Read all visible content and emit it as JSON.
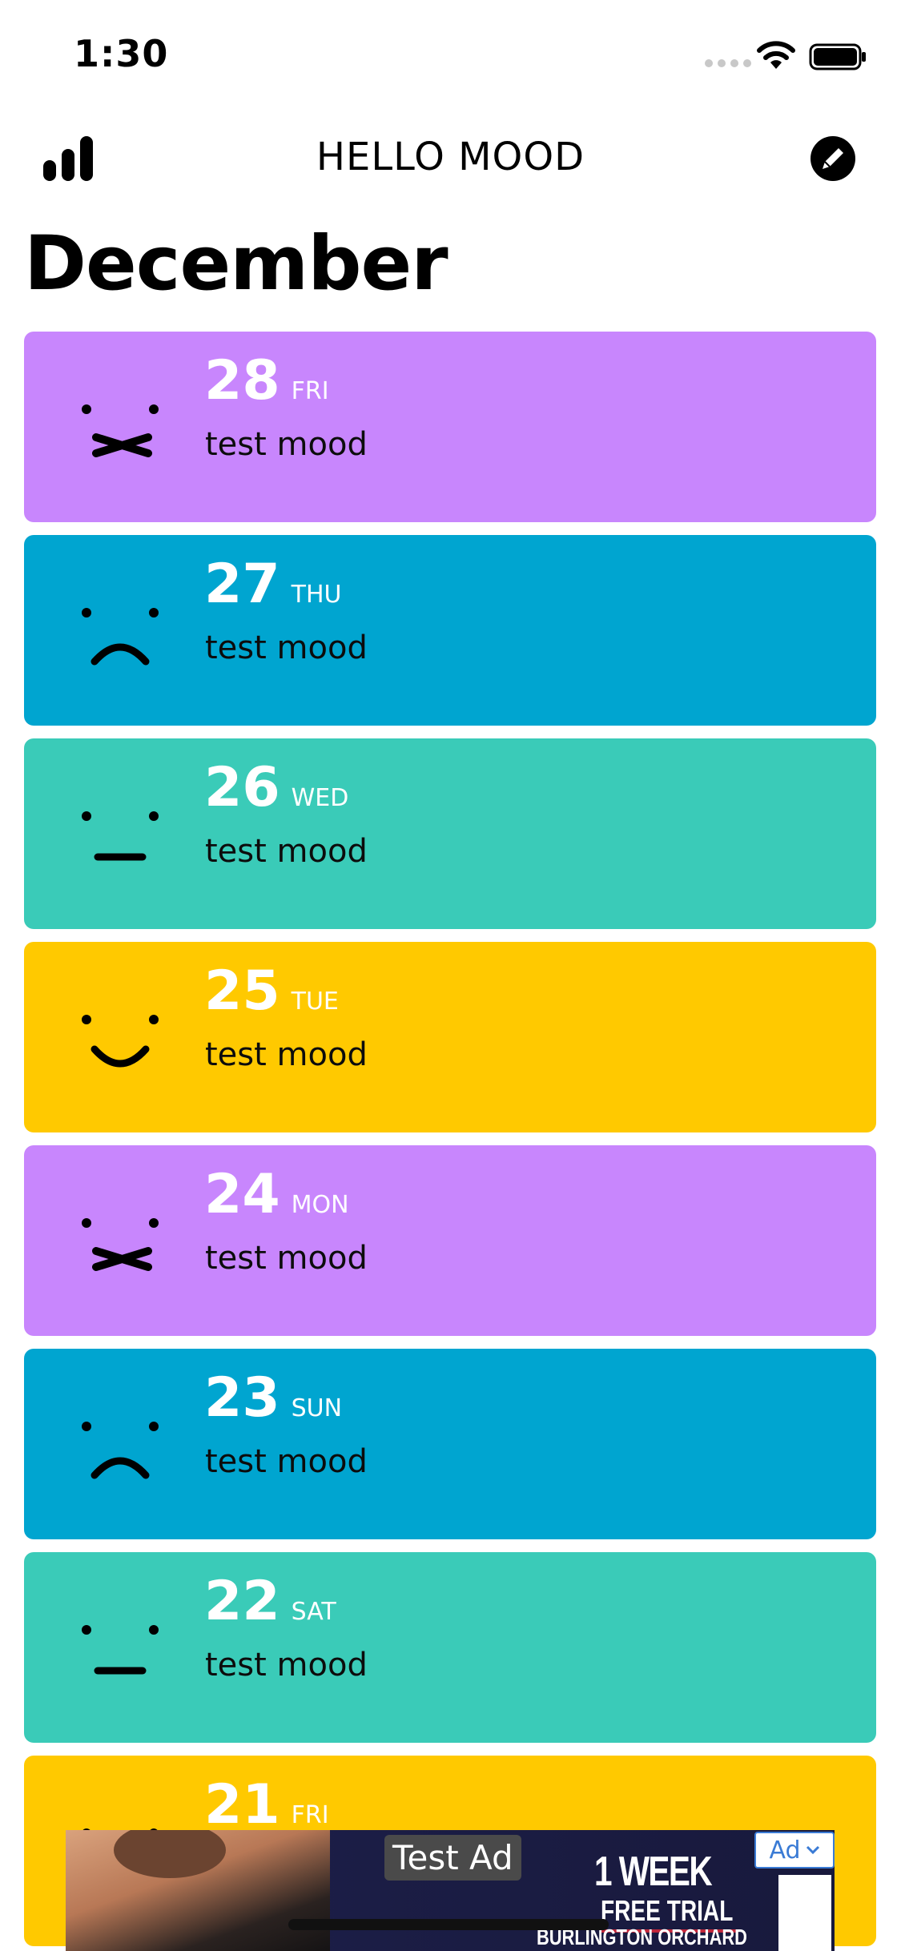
{
  "status_bar": {
    "time": "1:30"
  },
  "header": {
    "title": "HELLO MOOD",
    "left_icon": "stats-icon",
    "right_icon": "edit-icon"
  },
  "month": "December",
  "colors": {
    "purple": "#C886FD",
    "blue": "#00A5D0",
    "teal": "#3ACBB8",
    "yellow": "#FFC900"
  },
  "entries": [
    {
      "day": "28",
      "weekday": "FRI",
      "text": "test mood",
      "mood": "angry-face"
    },
    {
      "day": "27",
      "weekday": "THU",
      "text": "test mood",
      "mood": "sad-face"
    },
    {
      "day": "26",
      "weekday": "WED",
      "text": "test mood",
      "mood": "neutral-face"
    },
    {
      "day": "25",
      "weekday": "TUE",
      "text": "test mood",
      "mood": "happy-face"
    },
    {
      "day": "24",
      "weekday": "MON",
      "text": "test mood",
      "mood": "angry-face"
    },
    {
      "day": "23",
      "weekday": "SUN",
      "text": "test mood",
      "mood": "sad-face"
    },
    {
      "day": "22",
      "weekday": "SAT",
      "text": "test mood",
      "mood": "neutral-face"
    },
    {
      "day": "21",
      "weekday": "FRI",
      "text": "",
      "mood": "happy-face"
    }
  ],
  "ad": {
    "label": "Test Ad",
    "headline": "1 WEEK",
    "subline": "FREE TRIAL",
    "footer": "BURLINGTON ORCHARD",
    "badge": "Ad"
  }
}
